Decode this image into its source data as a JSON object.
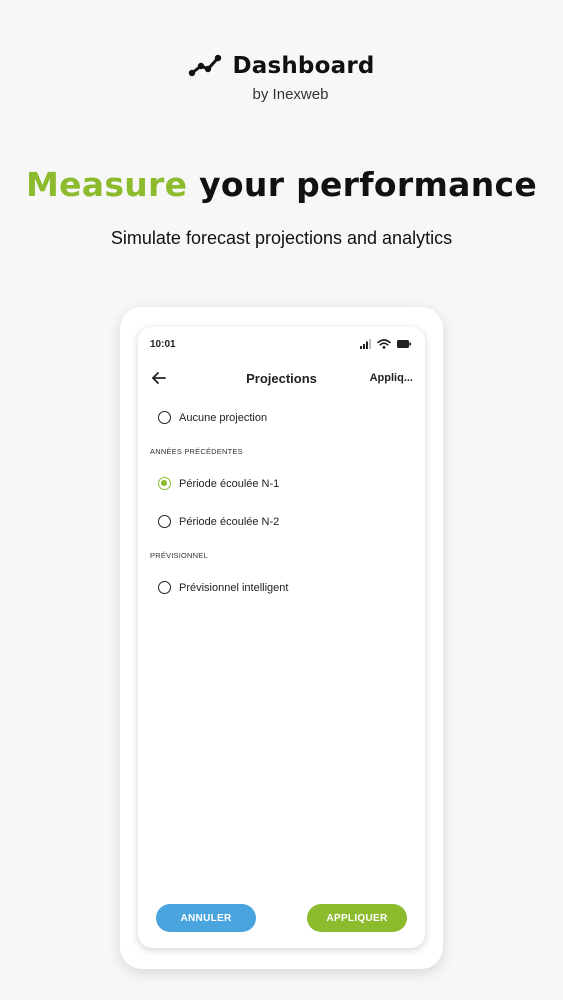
{
  "brand": {
    "title": "Dashboard",
    "subtitle": "by Inexweb",
    "logo_icon": "trend-line-icon"
  },
  "hero": {
    "accent": "Measure",
    "rest": "your performance",
    "tagline": "Simulate forecast projections and analytics"
  },
  "phone": {
    "status": {
      "time": "10:01",
      "icons": [
        "signal-icon",
        "wifi-icon",
        "battery-icon"
      ]
    },
    "appbar": {
      "title": "Projections",
      "action": "Appliq...",
      "back_icon": "back-arrow-icon"
    },
    "options": {
      "none": {
        "label": "Aucune projection",
        "checked": false
      },
      "section_previous": "ANNÉES PRÉCÉDENTES",
      "n1": {
        "label": "Période écoulée N-1",
        "checked": true
      },
      "n2": {
        "label": "Période écoulée N-2",
        "checked": false
      },
      "section_forecast": "PRÉVISIONNEL",
      "smart": {
        "label": "Prévisionnel intelligent",
        "checked": false
      }
    },
    "buttons": {
      "cancel": "ANNULER",
      "apply": "APPLIQUER"
    }
  },
  "colors": {
    "accent_green": "#8cbb2e",
    "button_blue": "#4aa5de",
    "background": "#f7f7f8"
  }
}
